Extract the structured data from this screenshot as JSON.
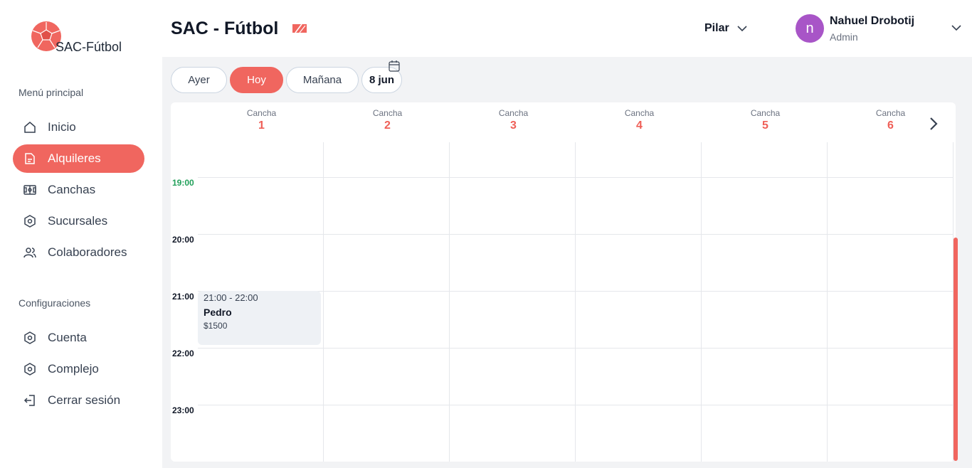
{
  "brand": {
    "logo_text": "SAC-Fútbol",
    "accent": "#f0665f"
  },
  "sidebar": {
    "main_section": "Menú principal",
    "main_items": [
      {
        "label": "Inicio",
        "icon": "home-icon"
      },
      {
        "label": "Alquileres",
        "icon": "document-icon",
        "active": true
      },
      {
        "label": "Canchas",
        "icon": "field-icon"
      },
      {
        "label": "Sucursales",
        "icon": "hexagon-icon"
      },
      {
        "label": "Colaboradores",
        "icon": "users-icon"
      }
    ],
    "config_section": "Configuraciones",
    "config_items": [
      {
        "label": "Cuenta",
        "icon": "hexagon-icon"
      },
      {
        "label": "Complejo",
        "icon": "hexagon-icon"
      },
      {
        "label": "Cerrar sesión",
        "icon": "logout-icon"
      }
    ]
  },
  "header": {
    "title": "SAC - Fútbol",
    "branch": "Pilar",
    "user": {
      "initial": "n",
      "name": "Nahuel Drobotij",
      "role": "Admin",
      "avatar_color": "#a855c7"
    }
  },
  "date_nav": {
    "yesterday": "Ayer",
    "today": "Hoy",
    "tomorrow": "Mañana",
    "date": "8 jun"
  },
  "courts": {
    "label": "Cancha",
    "numbers": [
      "1",
      "2",
      "3",
      "4",
      "5",
      "6"
    ]
  },
  "times": [
    "19:00",
    "20:00",
    "21:00",
    "22:00",
    "23:00"
  ],
  "events": [
    {
      "court": "1",
      "time": "21:00 - 22:00",
      "name": "Pedro",
      "price": "$1500"
    }
  ]
}
